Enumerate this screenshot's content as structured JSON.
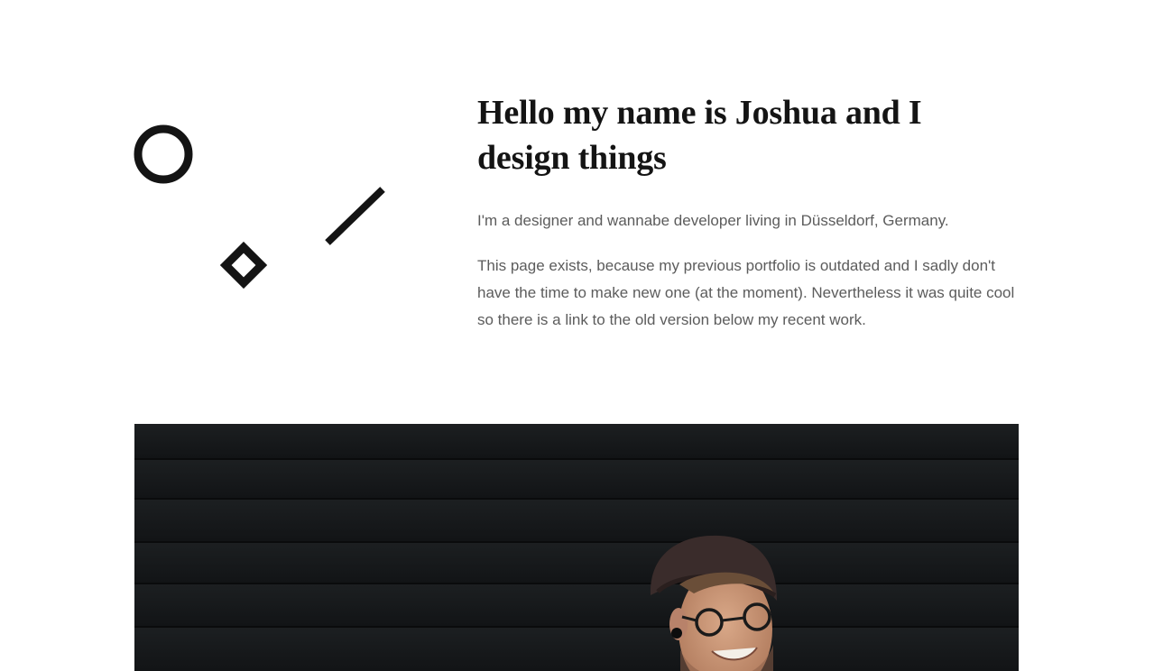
{
  "intro": {
    "headline": "Hello my name is Joshua and I design things",
    "paragraph_1": "I'm a designer and wannabe developer living in Düsseldorf, Germany.",
    "paragraph_2": "This page exists, because my previous portfolio is outdated and I sadly don't have the time to make new one (at the moment). Nevertheless it was quite cool so there is a link to the old version below my recent work."
  },
  "logo": {
    "shapes": [
      "circle",
      "diamond",
      "slash"
    ],
    "color": "#141414"
  },
  "hero": {
    "subject": "portrait-photo",
    "background_color": "#15181a"
  }
}
